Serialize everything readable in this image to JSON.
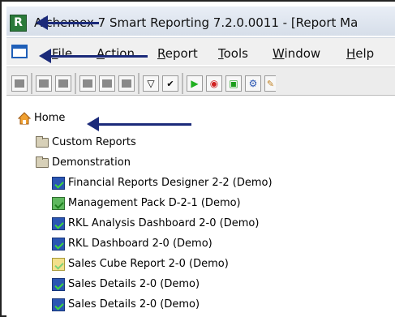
{
  "window": {
    "title": "Alchemex 7 Smart Reporting 7.2.0.0011 - [Report Ma",
    "logo_letter": "R"
  },
  "menu": {
    "items": [
      {
        "label": "File",
        "accel": "F"
      },
      {
        "label": "Action",
        "accel": "A"
      },
      {
        "label": "Report",
        "accel": "R"
      },
      {
        "label": "Tools",
        "accel": "T"
      },
      {
        "label": "Window",
        "accel": "W"
      },
      {
        "label": "Help",
        "accel": "H"
      }
    ]
  },
  "toolbar": {
    "buttons": [
      "delete",
      "trash",
      "properties",
      "refresh",
      "copy",
      "paste-group",
      "filter",
      "check",
      "run",
      "record",
      "window",
      "world",
      "paint"
    ]
  },
  "tree": {
    "root": {
      "label": "Home"
    },
    "folders": [
      {
        "label": "Custom Reports"
      },
      {
        "label": "Demonstration"
      }
    ],
    "reports": [
      {
        "label": "Financial Reports Designer 2-2 (Demo)",
        "icon": "report-locked-icon"
      },
      {
        "label": "Management Pack D-2-1 (Demo)",
        "icon": "report-locked-icon"
      },
      {
        "label": "RKL Analysis Dashboard 2-0 (Demo)",
        "icon": "report-icon"
      },
      {
        "label": "RKL Dashboard 2-0 (Demo)",
        "icon": "report-icon"
      },
      {
        "label": "Sales Cube Report 2-0 (Demo)",
        "icon": "cube-report-icon"
      },
      {
        "label": "Sales Details 2-0 (Demo)",
        "icon": "report-icon"
      },
      {
        "label": "Sales Details 2-0 (Demo)",
        "icon": "report-icon"
      }
    ]
  },
  "colors": {
    "arrow": "#1b2a7a",
    "logo": "#2a7a3a"
  }
}
